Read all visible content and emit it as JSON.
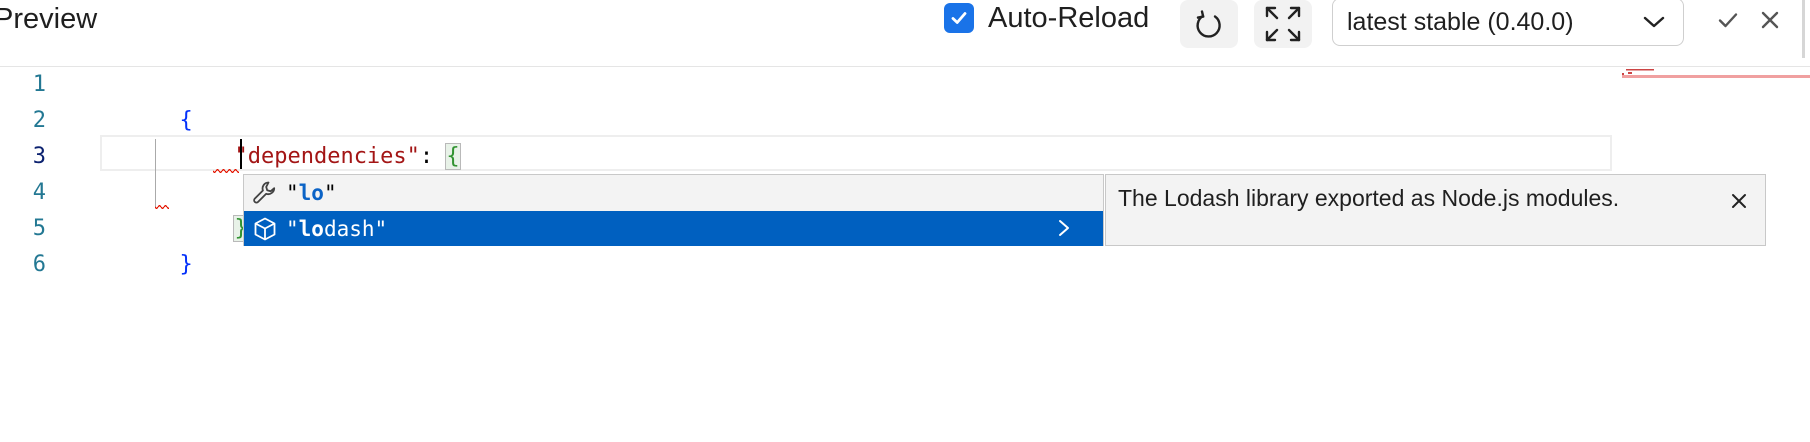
{
  "toolbar": {
    "title": "Preview",
    "auto_reload_label": "Auto-Reload",
    "auto_reload_checked": true,
    "version_selected": "latest stable (0.40.0)",
    "icons": {
      "reload": "reload-icon",
      "fullscreen": "fullscreen-icon",
      "dropdown": "chevron-down-icon",
      "accept": "check-icon",
      "close": "close-icon"
    }
  },
  "editor": {
    "line_numbers": [
      "1",
      "2",
      "3",
      "4",
      "5",
      "6"
    ],
    "active_line": "3",
    "lines": {
      "l1_brace": "{",
      "l2_key": "\"dependencies\"",
      "l2_colon": ": ",
      "l2_brace": "{",
      "l3_typed": "lo",
      "l4_brace": "}",
      "l5_brace": "}"
    }
  },
  "suggest": {
    "items": [
      {
        "prefix": "\"",
        "match": "lo",
        "suffix": "\"",
        "icon": "wrench-icon",
        "selected": false
      },
      {
        "prefix": "\"",
        "match": "lo",
        "suffix": "dash\"",
        "icon": "package-icon",
        "selected": true
      }
    ],
    "details": "The Lodash library exported as Node.js modules.",
    "icons": {
      "expand": "chevron-right-icon",
      "close": "close-icon"
    }
  },
  "colors": {
    "accent": "#1a73e8",
    "selection": "#0060c0",
    "string": "#a31515",
    "brace": "#0431fa",
    "line_number": "#237893",
    "error": "#e51400"
  }
}
